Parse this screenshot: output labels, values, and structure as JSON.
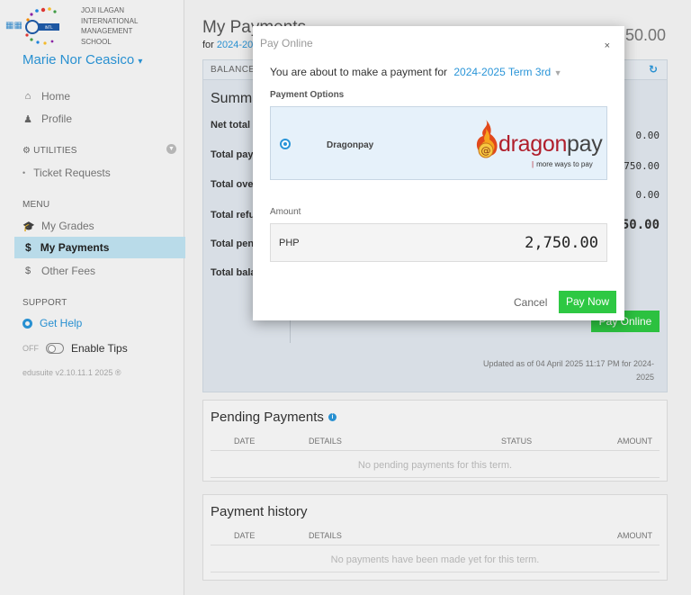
{
  "sidebar": {
    "school_lines": [
      "JOJI ILAGAN",
      "INTERNATIONAL",
      "MANAGEMENT",
      "SCHOOL"
    ],
    "user_name": "Marie Nor Ceasico",
    "home": "Home",
    "profile": "Profile",
    "utilities_title": "UTILITIES",
    "ticket_requests": "Ticket Requests",
    "menu_title": "MENU",
    "my_grades": "My Grades",
    "my_payments": "My Payments",
    "other_fees": "Other Fees",
    "support_title": "SUPPORT",
    "get_help": "Get Help",
    "tips_off": "OFF",
    "enable_tips": "Enable Tips",
    "version": "edusuite v2.10.11.1 2025 ®"
  },
  "main": {
    "title": "My Payments",
    "term_prefix": "for",
    "term_link": "2024-2025 Term 3rd",
    "total_right": "2,750.00",
    "balance_header": "BALANCE",
    "summary_title": "Summary",
    "summary_rows": [
      {
        "label": "Net total",
        "value": "0.00"
      },
      {
        "label": "Total payments",
        "value": "2,750.00"
      },
      {
        "label": "Total overpayments",
        "value": "0.00"
      },
      {
        "label": "Total refunds",
        "value": "2,750.00"
      },
      {
        "label": "Total pending",
        "value": ""
      },
      {
        "label": "Total balance",
        "value": ""
      }
    ],
    "pay_online_btn": "Pay Online",
    "updated_text": "Updated as of 04 April 2025 11:17 PM for 2024-2025",
    "pending_title": "Pending Payments",
    "pending_cols": {
      "date": "DATE",
      "details": "DETAILS",
      "status": "STATUS",
      "amount": "AMOUNT"
    },
    "pending_empty": "No pending payments for this term.",
    "history_title": "Payment history",
    "history_cols": {
      "date": "DATE",
      "details": "DETAILS",
      "amount": "AMOUNT"
    },
    "history_empty": "No payments have been made yet for this term."
  },
  "modal": {
    "title": "Pay Online",
    "close": "×",
    "intro": "You are about to make a payment for",
    "term": "2024-2025 Term 3rd",
    "options_label": "Payment Options",
    "option_name": "Dragonpay",
    "logo_dragon": "dragon",
    "logo_pay": "pay",
    "logo_tagline": "more ways to pay",
    "amount_label": "Amount",
    "currency": "PHP",
    "amount": "2,750.00",
    "cancel": "Cancel",
    "pay_now": "Pay Now"
  },
  "colors": {
    "accent": "#2a95d8",
    "success": "#2ec843",
    "brand_red": "#b01e2b"
  }
}
